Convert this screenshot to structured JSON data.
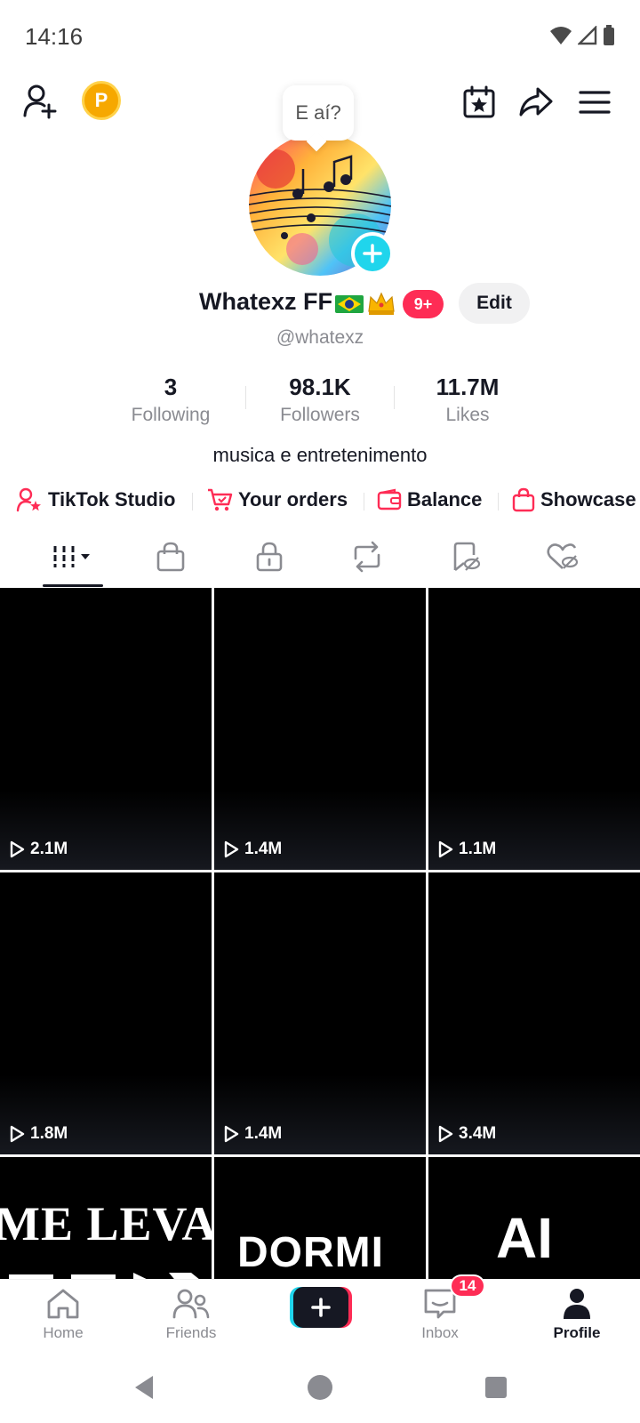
{
  "status_bar": {
    "time": "14:16"
  },
  "bubble": {
    "text": "E aí?"
  },
  "profile": {
    "display_name": "Whatexz FF",
    "notification_badge": "9+",
    "edit_label": "Edit",
    "handle": "@whatexz",
    "bio": "musica e entretenimento"
  },
  "stats": [
    {
      "value": "3",
      "label": "Following"
    },
    {
      "value": "98.1K",
      "label": "Followers"
    },
    {
      "value": "11.7M",
      "label": "Likes"
    }
  ],
  "shortcuts": [
    {
      "label": "TikTok Studio",
      "icon": "person-star-icon"
    },
    {
      "label": "Your orders",
      "icon": "cart-icon"
    },
    {
      "label": "Balance",
      "icon": "wallet-icon"
    },
    {
      "label": "Showcase",
      "icon": "bag-icon"
    }
  ],
  "tabs": [
    "videos-grid-icon",
    "shop-bag-icon",
    "lock-icon",
    "repost-icon",
    "bookmark-hidden-icon",
    "liked-hidden-icon"
  ],
  "videos": [
    {
      "views": "2.1M",
      "overlay": ""
    },
    {
      "views": "1.4M",
      "overlay": ""
    },
    {
      "views": "1.1M",
      "overlay": ""
    },
    {
      "views": "1.8M",
      "overlay": ""
    },
    {
      "views": "1.4M",
      "overlay": ""
    },
    {
      "views": "3.4M",
      "overlay": ""
    },
    {
      "views": "",
      "overlay": "ME LEVA"
    },
    {
      "views": "",
      "overlay": "DORMI"
    },
    {
      "views": "",
      "overlay": "AI"
    }
  ],
  "bottom_nav": {
    "home": "Home",
    "friends": "Friends",
    "inbox": "Inbox",
    "inbox_badge": "14",
    "profile": "Profile"
  },
  "colors": {
    "accent": "#fe2c55",
    "cyan": "#20d5ec",
    "coin": "#f6a800"
  }
}
